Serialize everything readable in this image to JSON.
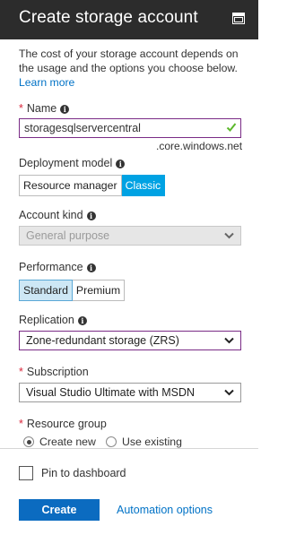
{
  "window": {
    "title": "Create storage account",
    "maximize_icon": "maximize-icon"
  },
  "description": {
    "text": "The cost of your storage account depends on the usage and the options you choose below.",
    "link": "Learn more"
  },
  "name_field": {
    "label": "Name",
    "required": "*",
    "value": "storagesqlservercentral",
    "suffix": ".core.windows.net",
    "valid_icon": "check-icon"
  },
  "deployment_model": {
    "label": "Deployment model",
    "options": [
      "Resource manager",
      "Classic"
    ],
    "selected": "Classic"
  },
  "account_kind": {
    "label": "Account kind",
    "value": "General purpose",
    "disabled": true
  },
  "performance": {
    "label": "Performance",
    "options": [
      "Standard",
      "Premium"
    ],
    "selected": "Standard"
  },
  "replication": {
    "label": "Replication",
    "value": "Zone-redundant storage (ZRS)"
  },
  "subscription": {
    "label": "Subscription",
    "required": "*",
    "value": "Visual Studio Ultimate with MSDN"
  },
  "resource_group": {
    "label": "Resource group",
    "required": "*",
    "options": [
      "Create new",
      "Use existing"
    ],
    "selected": "Create new"
  },
  "footer": {
    "pin_label": "Pin to dashboard",
    "pinned": false,
    "create_label": "Create",
    "automation_label": "Automation options"
  },
  "colors": {
    "titlebar": "#2c2c2c",
    "accent": "#0072c6",
    "selected_toggle": "#00a2e3",
    "focus_border": "#7a2b86",
    "valid": "#5cb82b",
    "required": "#d9263a"
  }
}
